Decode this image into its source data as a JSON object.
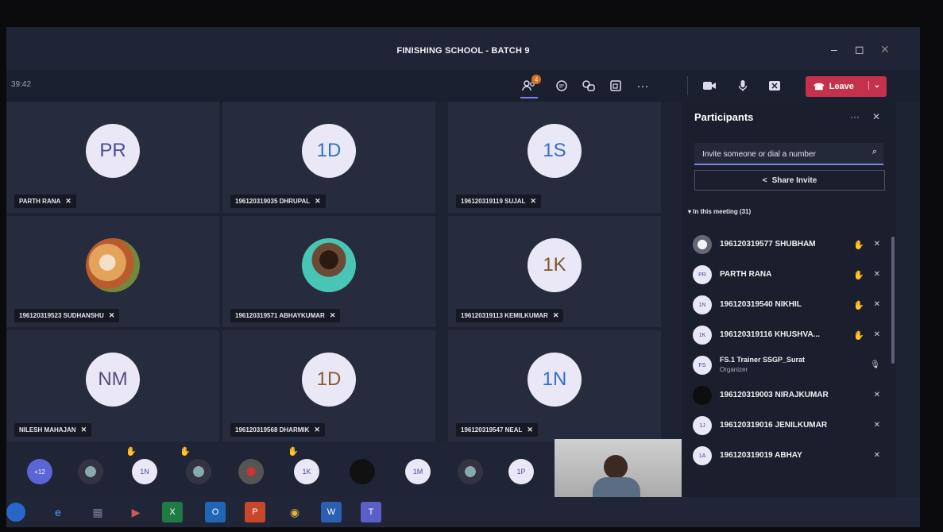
{
  "window": {
    "title": "FINISHING SCHOOL - BATCH 9",
    "minimize": "–",
    "maximize": "◻",
    "close": "✕"
  },
  "toolbar": {
    "timer": "39:42",
    "participants_badge": "4",
    "leave_label": "Leave",
    "icons": [
      "people-icon",
      "chat-icon",
      "reactions-icon",
      "rooms-icon",
      "more-icon",
      "camera-icon",
      "mic-icon",
      "share-icon"
    ]
  },
  "tiles": [
    {
      "initials": "PR",
      "name": "PARTH RANA"
    },
    {
      "initials": "1D",
      "name": "196120319035 DHRUPAL"
    },
    {
      "initials": "1S",
      "name": "196120319119 SUJAL"
    },
    {
      "initials": "",
      "name": "196120319523 SUDHANSHU"
    },
    {
      "initials": "",
      "name": "196120319571 ABHAYKUMAR"
    },
    {
      "initials": "1K",
      "name": "196120319113 KEMILKUMAR"
    },
    {
      "initials": "NM",
      "name": "NILESH MAHAJAN"
    },
    {
      "initials": "1D",
      "name": "196120319568 DHARMIK"
    },
    {
      "initials": "1N",
      "name": "196120319547 NEAL"
    }
  ],
  "strip": {
    "overflow": "+12",
    "avatars": [
      "1N",
      "1K",
      "1M",
      "1P"
    ]
  },
  "panel": {
    "title": "Participants",
    "invite_placeholder": "Invite someone or dial a number",
    "share_invite": "Share Invite",
    "section": "In this meeting (31)",
    "participants": [
      {
        "initials": "",
        "name": "196120319577 SHUBHAM"
      },
      {
        "initials": "PR",
        "name": "PARTH RANA"
      },
      {
        "initials": "1N",
        "name": "196120319540 NIKHIL"
      },
      {
        "initials": "1K",
        "name": "196120319116 KHUSHVA..."
      },
      {
        "initials": "FS",
        "name": "FS.1 Trainer SSGP_Surat",
        "role": "Organizer"
      },
      {
        "initials": "",
        "name": "196120319003 NIRAJKUMAR"
      },
      {
        "initials": "1J",
        "name": "196120319016 JENILKUMAR"
      },
      {
        "initials": "1A",
        "name": "196120319019 ABHAY"
      }
    ]
  },
  "colors": {
    "accent": "#7b83eb",
    "leave": "#c4314b",
    "background": "#1e2333"
  }
}
